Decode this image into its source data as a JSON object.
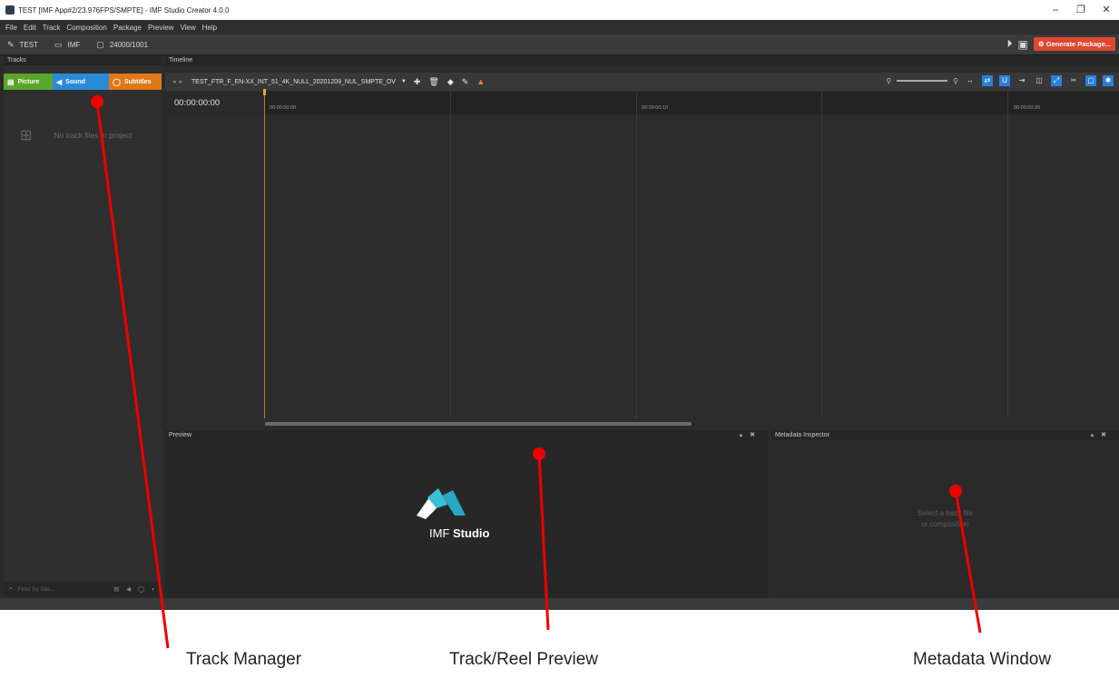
{
  "window": {
    "title": "TEST [IMF App#2/23.976FPS/SMPTE] - IMF Studio Creator 4.0.0",
    "controls": [
      "–",
      "❐",
      "✕"
    ]
  },
  "menu": [
    "File",
    "Edit",
    "Track",
    "Composition",
    "Package",
    "Preview",
    "View",
    "Help"
  ],
  "toolbar": {
    "project": "TEST",
    "format": "IMF",
    "framerate": "24000/1001",
    "generate_label": "Generate Package..."
  },
  "tracks_panel": {
    "title": "Tracks",
    "buttons": [
      {
        "label": "Picture",
        "color": "#5ba52b"
      },
      {
        "label": "Sound",
        "color": "#2a8ad8"
      },
      {
        "label": "Subtitles",
        "color": "#e07818"
      }
    ],
    "empty_text": "No track files in project",
    "filter_placeholder": "Filter by title..."
  },
  "timeline": {
    "title": "Timeline",
    "composition": "TEST_FTR_F_EN-XX_INT_51_4K_NULL_20201209_NUL_SMPTE_OV",
    "timecode": "00:00:00:00",
    "ruler": [
      "00:00:00:00",
      "00:00:00:10",
      "00:00:00:20"
    ]
  },
  "preview": {
    "title": "Preview",
    "logo_word1": "IMF",
    "logo_word2": "Studio"
  },
  "metadata": {
    "title": "Metadata Inspector",
    "hint_line1": "Select a track file",
    "hint_line2": "or composition"
  },
  "annotations": {
    "track_manager": "Track Manager",
    "track_preview": "Track/Reel Preview",
    "metadata_window": "Metadata Window",
    "arrow_color": "#ee0000"
  }
}
